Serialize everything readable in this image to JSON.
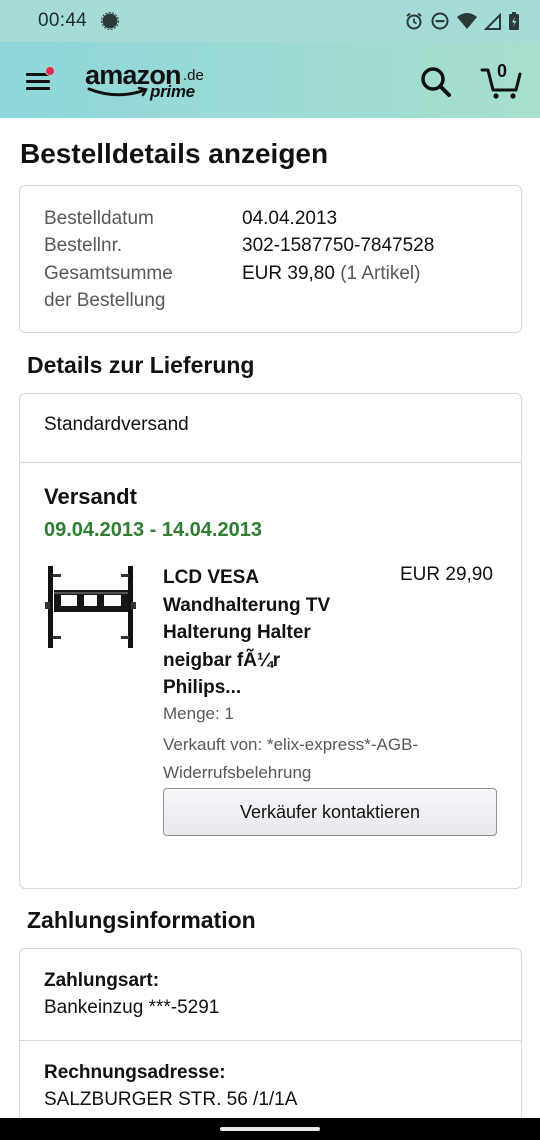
{
  "status_bar": {
    "time": "00:44",
    "icons": [
      "signal-app-icon",
      "alarm-icon",
      "do-not-disturb-icon",
      "wifi-icon",
      "cell-signal-icon",
      "battery-icon"
    ]
  },
  "header": {
    "menu_icon": "hamburger-menu-icon",
    "notification_dot_color": "#e3274e",
    "logo": {
      "word": "amazon",
      "suffix": ".de",
      "sub": "prime"
    },
    "search_icon": "search-icon",
    "cart_icon": "cart-icon",
    "cart_count": "0",
    "background": [
      "#8fd6da",
      "#a7dfce"
    ]
  },
  "page_title": "Bestelldetails anzeigen",
  "order_summary": {
    "date_label": "Bestelldatum",
    "date_value": "04.04.2013",
    "number_label": "Bestellnr.",
    "number_value": "302-1587750-7847528",
    "total_label_line1": "Gesamtsumme",
    "total_label_line2": "der Bestellung",
    "total_value": "EUR 39,80",
    "total_items": "(1 Artikel)"
  },
  "delivery": {
    "section_title": "Details zur Lieferung",
    "shipping_method": "Standardversand",
    "status": "Versandt",
    "dates": "09.04.2013 - 14.04.2013",
    "status_color": "#2e7d32",
    "item": {
      "image_icon": "tv-wall-mount-image",
      "title_lines": [
        "LCD VESA",
        "Wandhalterung TV",
        "Halterung Halter",
        "neigbar fÃ¼r",
        "Philips..."
      ],
      "price": "EUR 29,90",
      "quantity": "Menge: 1",
      "seller_line1": "Verkauft von: *elix-express*-AGB-",
      "seller_line2": "Widerrufsbelehrung",
      "contact_button": "Verkäufer kontaktieren"
    }
  },
  "payment": {
    "section_title": "Zahlungsinformation",
    "method_label": "Zahlungsart:",
    "method_value": "Bankeinzug ***-5291",
    "billing_label": "Rechnungsadresse:",
    "billing_value": "SALZBURGER STR. 56 /1/1A"
  }
}
